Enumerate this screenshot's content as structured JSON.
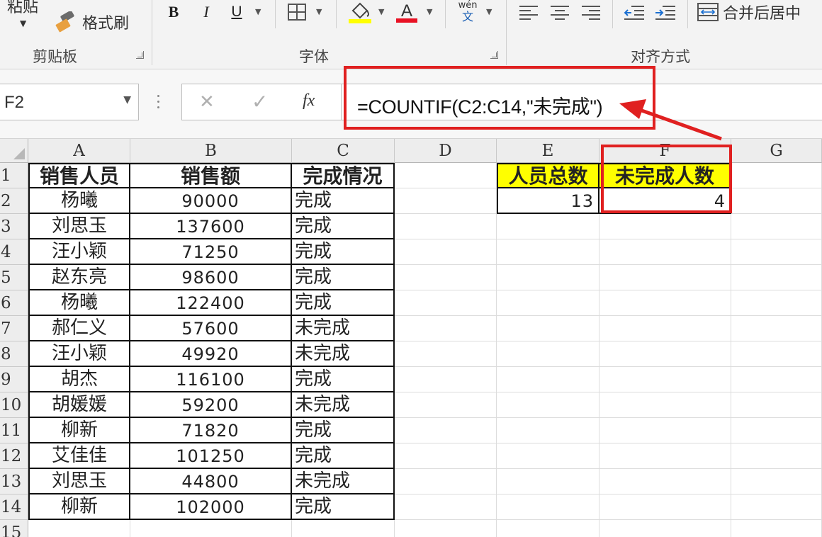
{
  "ribbon": {
    "paste_label": "粘贴",
    "format_painter_label": "格式刷",
    "groups": {
      "clipboard": "剪贴板",
      "font": "字体",
      "alignment": "对齐方式"
    },
    "bold": "B",
    "italic": "I",
    "underline": "U",
    "phonetic": "wén",
    "phonetic_char": "文",
    "merge_center_label": "合并后居中",
    "font_color": "#e81123",
    "fill_color": "#ffff00"
  },
  "formula_bar": {
    "name_box": "F2",
    "cancel_icon": "✕",
    "enter_icon": "✓",
    "fx_label": "fx",
    "formula": "=COUNTIF(C2:C14,\"未完成\")"
  },
  "columns": [
    "A",
    "B",
    "C",
    "D",
    "E",
    "F",
    "G"
  ],
  "rows": [
    "1",
    "2",
    "3",
    "4",
    "5",
    "6",
    "7",
    "8",
    "9",
    "10",
    "11",
    "12",
    "13",
    "14",
    "15"
  ],
  "table": {
    "headers": [
      "销售人员",
      "销售额",
      "完成情况"
    ],
    "data": [
      [
        "杨曦",
        "90000",
        "完成"
      ],
      [
        "刘思玉",
        "137600",
        "完成"
      ],
      [
        "汪小颖",
        "71250",
        "完成"
      ],
      [
        "赵东亮",
        "98600",
        "完成"
      ],
      [
        "杨曦",
        "122400",
        "完成"
      ],
      [
        "郝仁义",
        "57600",
        "未完成"
      ],
      [
        "汪小颖",
        "49920",
        "未完成"
      ],
      [
        "胡杰",
        "116100",
        "完成"
      ],
      [
        "胡媛媛",
        "59200",
        "未完成"
      ],
      [
        "柳新",
        "71820",
        "完成"
      ],
      [
        "艾佳佳",
        "101250",
        "完成"
      ],
      [
        "刘思玉",
        "44800",
        "未完成"
      ],
      [
        "柳新",
        "102000",
        "完成"
      ]
    ]
  },
  "summary": {
    "e1": "人员总数",
    "f1": "未完成人数",
    "e2": "13",
    "f2": "4"
  },
  "colors": {
    "highlight_red": "#e02020",
    "header_yellow": "#ffff00"
  }
}
